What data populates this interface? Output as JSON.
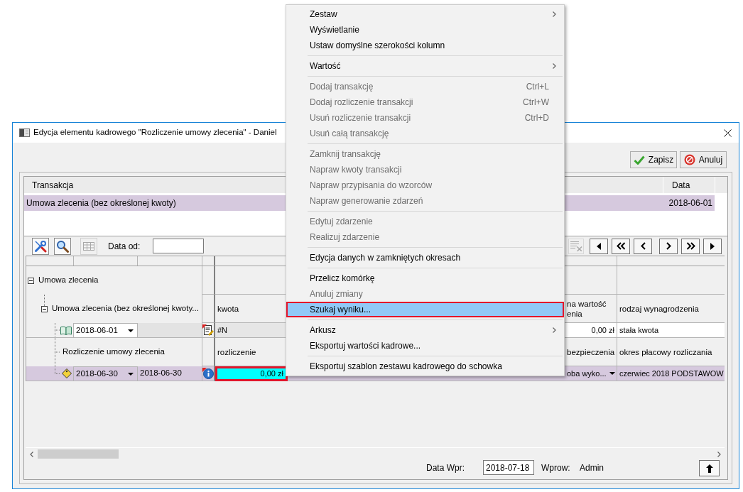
{
  "window": {
    "title": "Edycja elementu kadrowego \"Rozliczenie umowy zlecenia\" - Daniel"
  },
  "actions": [
    {
      "label": "Zapisz"
    },
    {
      "label": "Anuluj"
    }
  ],
  "transactions": {
    "columns": [
      "Transakcja",
      "Data"
    ],
    "rows": [
      {
        "cells": [
          "Umowa zlecenia (bez określonej kwoty)",
          "2018-06-01"
        ],
        "selected": true
      }
    ]
  },
  "toolbar": {
    "left_buttons": [
      {
        "disabled": false
      },
      {
        "disabled": false
      },
      {
        "disabled": true
      }
    ],
    "date_from_label": "Data od:",
    "right_buttons": [
      {
        "disabled": true
      }
    ]
  },
  "grid": {
    "rows": [
      {
        "kind": "group",
        "label": "Umowa zlecenia",
        "expanded": true,
        "children": [
          {
            "kind": "group",
            "label": "Umowa zlecenia (bez określonej kwoty...",
            "expanded": true,
            "cells": [
              {
                "text": "kwota"
              },
              {
                "text": "na wartość\nenia"
              },
              {
                "text": "rodzaj wynagrodzenia"
              }
            ],
            "children": [
              {
                "kind": "entry",
                "selected": false,
                "date_from": "2018-06-01",
                "cells": [
                  {
                    "text": "#N",
                    "kind": "readonly",
                    "active": false
                  },
                  {
                    "text": "0,00 zł",
                    "kind": "number",
                    "active": false
                  },
                  {
                    "text": "stała kwota",
                    "kind": "text",
                    "active": false
                  }
                ]
              },
              {
                "kind": "label",
                "label": "Rozliczenie umowy zlecenia",
                "cells": [
                  {
                    "text": "rozliczenie"
                  },
                  {
                    "text": "bezpieczenia"
                  },
                  {
                    "text": "okres płacowy rozliczania"
                  }
                ]
              },
              {
                "kind": "settlement",
                "selected": true,
                "date_from": "2018-06-30",
                "date_to": "2018-06-30",
                "cells": [
                  {
                    "text": "0,00 zł",
                    "kind": "number",
                    "active": true
                  },
                  {
                    "text": "oba wyko...",
                    "kind": "dropdown",
                    "active": false
                  },
                  {
                    "text": "czerwiec 2018 PODSTAWOW",
                    "kind": "text",
                    "active": false
                  }
                ]
              }
            ]
          }
        ]
      }
    ]
  },
  "status_bar": {
    "date_label": "Data Wpr:",
    "date_value": "2018-07-18",
    "user_label": "Wprow:",
    "user_value": "Admin"
  },
  "menu": {
    "items": [
      {
        "kind": "item",
        "label": "Zestaw",
        "submenu": true,
        "disabled": false,
        "selected": false
      },
      {
        "kind": "item",
        "label": "Wyświetlanie",
        "submenu": false,
        "disabled": false,
        "selected": false
      },
      {
        "kind": "item",
        "label": "Ustaw domyślne szerokości kolumn",
        "submenu": false,
        "disabled": false,
        "selected": false
      },
      {
        "kind": "separator"
      },
      {
        "kind": "item",
        "label": "Wartość",
        "submenu": true,
        "disabled": false,
        "selected": false
      },
      {
        "kind": "separator"
      },
      {
        "kind": "item",
        "label": "Dodaj transakcję",
        "shortcut": "Ctrl+L",
        "submenu": false,
        "disabled": true,
        "selected": false
      },
      {
        "kind": "item",
        "label": "Dodaj rozliczenie transakcji",
        "shortcut": "Ctrl+W",
        "submenu": false,
        "disabled": true,
        "selected": false
      },
      {
        "kind": "item",
        "label": "Usuń rozliczenie transakcji",
        "shortcut": "Ctrl+D",
        "submenu": false,
        "disabled": true,
        "selected": false
      },
      {
        "kind": "item",
        "label": "Usuń całą transakcję",
        "submenu": false,
        "disabled": true,
        "selected": false
      },
      {
        "kind": "separator"
      },
      {
        "kind": "item",
        "label": "Zamknij transakcję",
        "submenu": false,
        "disabled": true,
        "selected": false
      },
      {
        "kind": "item",
        "label": "Napraw kwoty transakcji",
        "submenu": false,
        "disabled": true,
        "selected": false
      },
      {
        "kind": "item",
        "label": "Napraw przypisania do wzorców",
        "submenu": false,
        "disabled": true,
        "selected": false
      },
      {
        "kind": "item",
        "label": "Napraw generowanie zdarzeń",
        "submenu": false,
        "disabled": true,
        "selected": false
      },
      {
        "kind": "separator"
      },
      {
        "kind": "item",
        "label": "Edytuj zdarzenie",
        "submenu": false,
        "disabled": true,
        "selected": false
      },
      {
        "kind": "item",
        "label": "Realizuj zdarzenie",
        "submenu": false,
        "disabled": true,
        "selected": false
      },
      {
        "kind": "separator"
      },
      {
        "kind": "item",
        "label": "Edycja danych w zamkniętych okresach",
        "submenu": false,
        "disabled": false,
        "selected": false
      },
      {
        "kind": "separator"
      },
      {
        "kind": "item",
        "label": "Przelicz komórkę",
        "submenu": false,
        "disabled": false,
        "selected": false
      },
      {
        "kind": "item",
        "label": "Anuluj zmiany",
        "submenu": false,
        "disabled": true,
        "selected": false
      },
      {
        "kind": "item",
        "label": "Szukaj wyniku...",
        "submenu": false,
        "disabled": false,
        "selected": true
      },
      {
        "kind": "separator"
      },
      {
        "kind": "item",
        "label": "Arkusz",
        "submenu": true,
        "disabled": false,
        "selected": false
      },
      {
        "kind": "item",
        "label": "Eksportuj wartości kadrowe...",
        "submenu": false,
        "disabled": false,
        "selected": false
      },
      {
        "kind": "separator"
      },
      {
        "kind": "item",
        "label": "Eksportuj szablon zestawu kadrowego do schowka",
        "submenu": false,
        "disabled": false,
        "selected": false
      }
    ]
  }
}
